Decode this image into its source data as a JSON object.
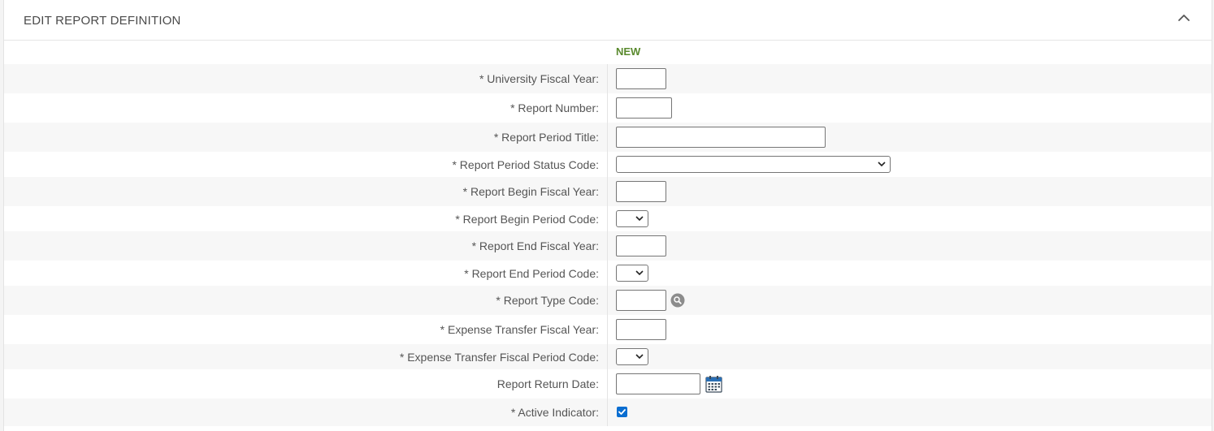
{
  "panel": {
    "title": "EDIT REPORT DEFINITION",
    "collapse_icon": "chevron-up-icon",
    "column_label": "NEW"
  },
  "fields": {
    "university_fiscal_year": {
      "label": "*  University Fiscal Year:",
      "value": ""
    },
    "report_number": {
      "label": "*  Report Number:",
      "value": ""
    },
    "report_period_title": {
      "label": "*  Report Period Title:",
      "value": ""
    },
    "report_period_status_code": {
      "label": "*  Report Period Status Code:",
      "value": ""
    },
    "report_begin_fiscal_year": {
      "label": "*  Report Begin Fiscal Year:",
      "value": ""
    },
    "report_begin_period_code": {
      "label": "*  Report Begin Period Code:",
      "value": ""
    },
    "report_end_fiscal_year": {
      "label": "*  Report End Fiscal Year:",
      "value": ""
    },
    "report_end_period_code": {
      "label": "*  Report End Period Code:",
      "value": ""
    },
    "report_type_code": {
      "label": "*  Report Type Code:",
      "value": "",
      "lookup_icon": "search-icon"
    },
    "expense_transfer_fiscal_year": {
      "label": "*  Expense Transfer Fiscal Year:",
      "value": ""
    },
    "expense_transfer_fiscal_period_code": {
      "label": "*  Expense Transfer Fiscal Period Code:",
      "value": ""
    },
    "report_return_date": {
      "label": "Report Return Date:",
      "value": "",
      "calendar_icon": "calendar-icon"
    },
    "active_indicator": {
      "label": "*  Active Indicator:",
      "checked": true
    }
  },
  "colors": {
    "new_label": "#5a8a2e",
    "row_shade": "#f7f7f7",
    "checkbox": "#0a6ed1"
  }
}
